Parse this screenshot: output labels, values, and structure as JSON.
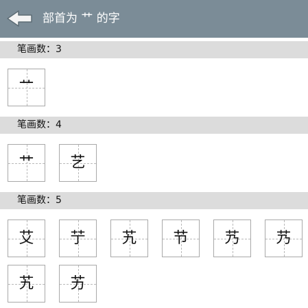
{
  "header": {
    "title": "部首为 艹 的字",
    "back_icon": "back-arrow-icon",
    "background_color": "#7b8c97"
  },
  "sections": [
    {
      "label": "笔画数：3",
      "chars": [
        "艹"
      ]
    },
    {
      "label": "笔画数：4",
      "chars": [
        "艹",
        "艺"
      ]
    },
    {
      "label": "笔画数：5",
      "chars": [
        "艾",
        "艼",
        "艽",
        "节",
        "艿",
        "艿",
        "艽",
        "艻"
      ]
    }
  ]
}
